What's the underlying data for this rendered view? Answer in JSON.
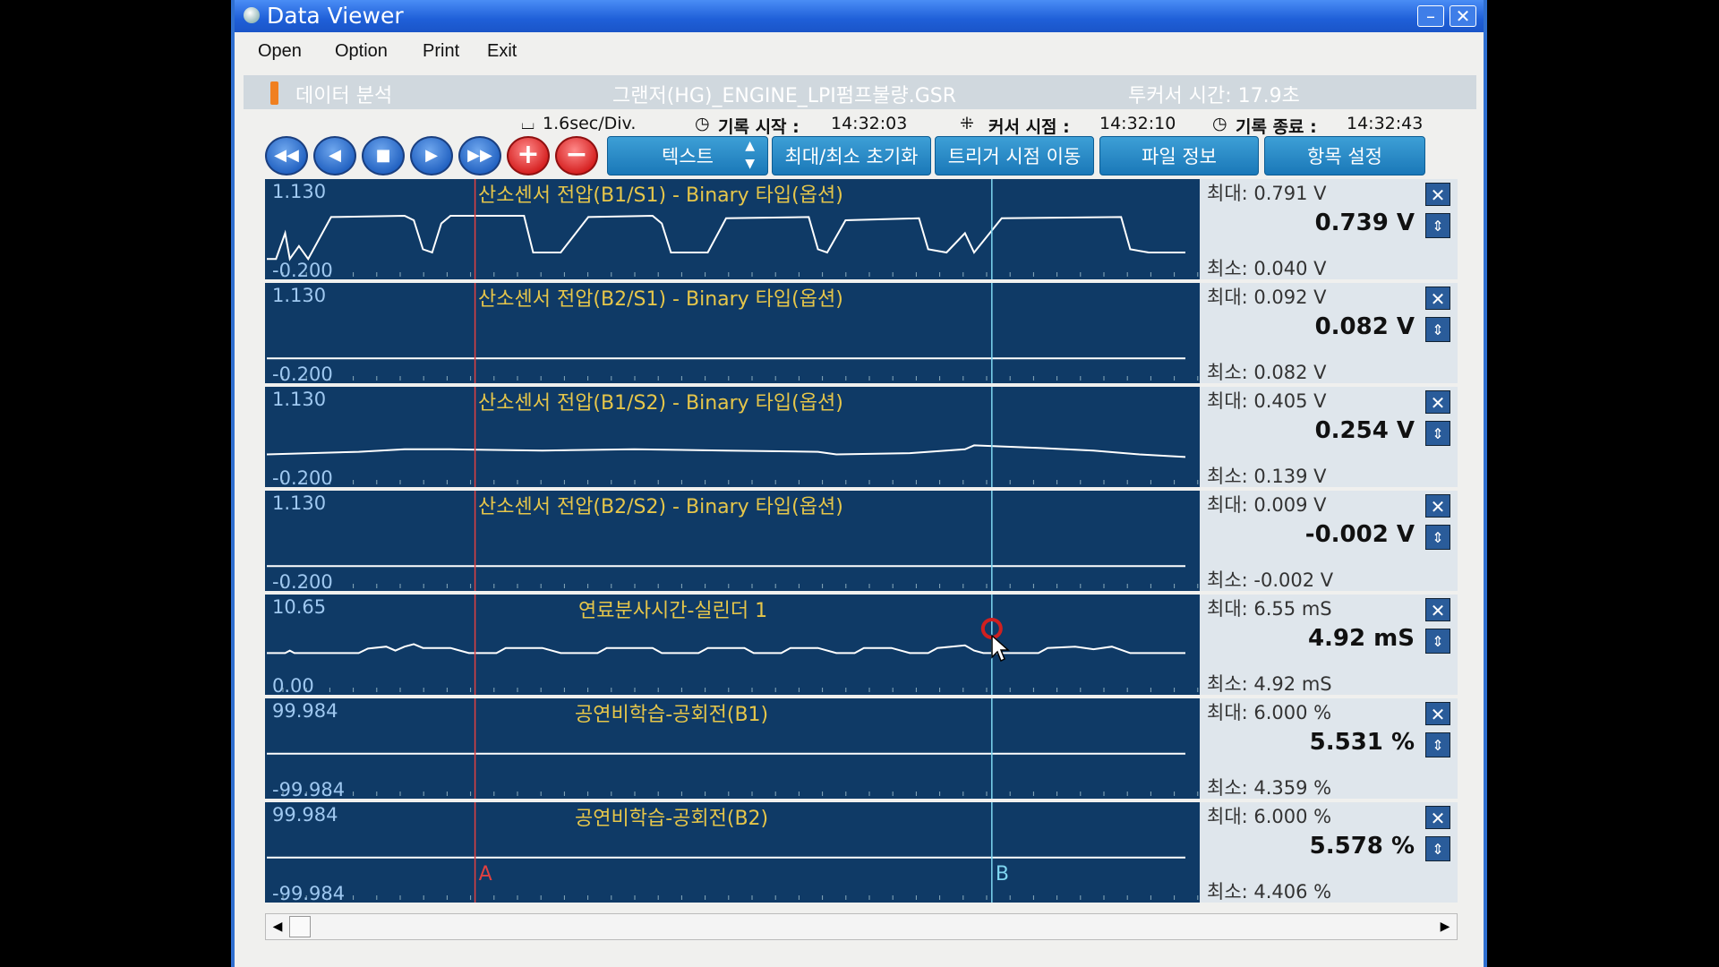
{
  "window": {
    "title": "Data Viewer",
    "minimize_icon": "minimize-icon",
    "close_icon": "close-icon"
  },
  "menu": [
    "Open",
    "Option",
    "Print",
    "Exit"
  ],
  "info": {
    "section": "데이터 분석",
    "file": "그랜저(HG)_ENGINE_LPI펌프불량.GSR",
    "cursor_time": "투커서 시간: 17.9초"
  },
  "status": {
    "div": "1.6sec/Div.",
    "rec_start_label": "기록 시작 :",
    "rec_start": "14:32:03",
    "cursor_label": "커서 시점 :",
    "cursor": "14:32:10",
    "rec_end_label": "기록 종료 :",
    "rec_end": "14:32:43"
  },
  "toolbar": {
    "rewind": "rewind-icon",
    "prev": "prev-icon",
    "stop": "stop-icon",
    "next": "next-icon",
    "forward": "forward-icon",
    "add": "+",
    "remove": "−",
    "text": "텍스트",
    "reset_minmax": "최대/최소 초기화",
    "trigger": "트리거 시점 이동",
    "file_info": "파일 정보",
    "settings": "항목 설정"
  },
  "colors": {
    "plot_bg": "#0f3a66",
    "trace": "#ffffff",
    "cursor_a": "#e04040",
    "cursor_b": "#7fd6f0",
    "title": "#e6c64a"
  },
  "cursors": {
    "a_label": "A",
    "b_label": "B",
    "a_pos": 0.2247,
    "b_pos": 0.7776
  },
  "graphs": [
    {
      "title": "산소센서 전압(B1/S1) - Binary 타입(옵션)",
      "top": "1.130",
      "bottom": "-0.200",
      "max": "최대: 0.791 V",
      "cur": "0.739 V",
      "min": "최소: 0.040 V",
      "trace": [
        [
          0,
          0.15
        ],
        [
          0.01,
          0.15
        ],
        [
          0.02,
          0.55
        ],
        [
          0.025,
          0.15
        ],
        [
          0.035,
          0.35
        ],
        [
          0.045,
          0.15
        ],
        [
          0.07,
          0.8
        ],
        [
          0.15,
          0.82
        ],
        [
          0.16,
          0.75
        ],
        [
          0.17,
          0.3
        ],
        [
          0.18,
          0.25
        ],
        [
          0.19,
          0.7
        ],
        [
          0.2,
          0.82
        ],
        [
          0.28,
          0.82
        ],
        [
          0.29,
          0.25
        ],
        [
          0.32,
          0.25
        ],
        [
          0.35,
          0.8
        ],
        [
          0.42,
          0.82
        ],
        [
          0.43,
          0.7
        ],
        [
          0.44,
          0.25
        ],
        [
          0.48,
          0.25
        ],
        [
          0.5,
          0.78
        ],
        [
          0.59,
          0.8
        ],
        [
          0.6,
          0.3
        ],
        [
          0.61,
          0.25
        ],
        [
          0.63,
          0.75
        ],
        [
          0.71,
          0.78
        ],
        [
          0.72,
          0.3
        ],
        [
          0.74,
          0.25
        ],
        [
          0.76,
          0.55
        ],
        [
          0.77,
          0.25
        ],
        [
          0.8,
          0.78
        ],
        [
          0.93,
          0.8
        ],
        [
          0.94,
          0.3
        ],
        [
          0.96,
          0.25
        ],
        [
          1,
          0.25
        ]
      ]
    },
    {
      "title": "산소센서 전압(B2/S1) - Binary 타입(옵션)",
      "top": "1.130",
      "bottom": "-0.200",
      "max": "최대: 0.092 V",
      "cur": "0.082 V",
      "min": "최소: 0.082 V",
      "trace": [
        [
          0,
          0.22
        ],
        [
          1,
          0.22
        ]
      ]
    },
    {
      "title": "산소센서 전압(B1/S2) - Binary 타입(옵션)",
      "top": "1.130",
      "bottom": "-0.200",
      "max": "최대: 0.405 V",
      "cur": "0.254 V",
      "min": "최소: 0.139 V",
      "trace": [
        [
          0,
          0.34
        ],
        [
          0.1,
          0.38
        ],
        [
          0.15,
          0.42
        ],
        [
          0.2,
          0.42
        ],
        [
          0.3,
          0.4
        ],
        [
          0.4,
          0.42
        ],
        [
          0.5,
          0.4
        ],
        [
          0.6,
          0.38
        ],
        [
          0.62,
          0.34
        ],
        [
          0.7,
          0.36
        ],
        [
          0.76,
          0.42
        ],
        [
          0.77,
          0.48
        ],
        [
          0.84,
          0.44
        ],
        [
          0.9,
          0.4
        ],
        [
          0.95,
          0.34
        ],
        [
          1,
          0.3
        ]
      ]
    },
    {
      "title": "산소센서 전압(B2/S2) - Binary 타입(옵션)",
      "top": "1.130",
      "bottom": "-0.200",
      "max": "최대: 0.009 V",
      "cur": "-0.002 V",
      "min": "최소: -0.002 V",
      "trace": [
        [
          0,
          0.22
        ],
        [
          1,
          0.22
        ]
      ]
    },
    {
      "title": "연료분사시간-실린더 1",
      "top": "10.65",
      "bottom": "0.00",
      "max": "최대:  6.55 mS",
      "cur": "4.92 mS",
      "min": "최소:  4.92 mS",
      "trace": [
        [
          0,
          0.48
        ],
        [
          0.02,
          0.48
        ],
        [
          0.025,
          0.52
        ],
        [
          0.03,
          0.48
        ],
        [
          0.1,
          0.48
        ],
        [
          0.11,
          0.55
        ],
        [
          0.13,
          0.58
        ],
        [
          0.14,
          0.52
        ],
        [
          0.15,
          0.58
        ],
        [
          0.16,
          0.62
        ],
        [
          0.17,
          0.56
        ],
        [
          0.2,
          0.56
        ],
        [
          0.22,
          0.48
        ],
        [
          0.25,
          0.48
        ],
        [
          0.26,
          0.56
        ],
        [
          0.3,
          0.56
        ],
        [
          0.32,
          0.48
        ],
        [
          0.36,
          0.48
        ],
        [
          0.37,
          0.56
        ],
        [
          0.42,
          0.56
        ],
        [
          0.43,
          0.48
        ],
        [
          0.47,
          0.48
        ],
        [
          0.48,
          0.56
        ],
        [
          0.52,
          0.56
        ],
        [
          0.53,
          0.48
        ],
        [
          0.56,
          0.48
        ],
        [
          0.57,
          0.56
        ],
        [
          0.6,
          0.56
        ],
        [
          0.62,
          0.48
        ],
        [
          0.64,
          0.48
        ],
        [
          0.65,
          0.56
        ],
        [
          0.68,
          0.56
        ],
        [
          0.7,
          0.48
        ],
        [
          0.72,
          0.48
        ],
        [
          0.73,
          0.56
        ],
        [
          0.76,
          0.6
        ],
        [
          0.77,
          0.52
        ],
        [
          0.78,
          0.48
        ],
        [
          0.84,
          0.48
        ],
        [
          0.85,
          0.56
        ],
        [
          0.88,
          0.58
        ],
        [
          0.9,
          0.54
        ],
        [
          0.92,
          0.58
        ],
        [
          0.94,
          0.48
        ],
        [
          1,
          0.48
        ]
      ]
    },
    {
      "title": "공연비학습-공회전(B1)",
      "top": "99.984",
      "bottom": "-99.984",
      "max": "최대: 6.000 %",
      "cur": "5.531 %",
      "min": "최소: 4.359 %",
      "trace": [
        [
          0,
          0.53
        ],
        [
          1,
          0.53
        ]
      ]
    },
    {
      "title": "공연비학습-공회전(B2)",
      "top": "99.984",
      "bottom": "-99.984",
      "max": "최대: 6.000 %",
      "cur": "5.578 %",
      "min": "최소: 4.406 %",
      "trace": [
        [
          0,
          0.53
        ],
        [
          1,
          0.53
        ]
      ]
    }
  ]
}
